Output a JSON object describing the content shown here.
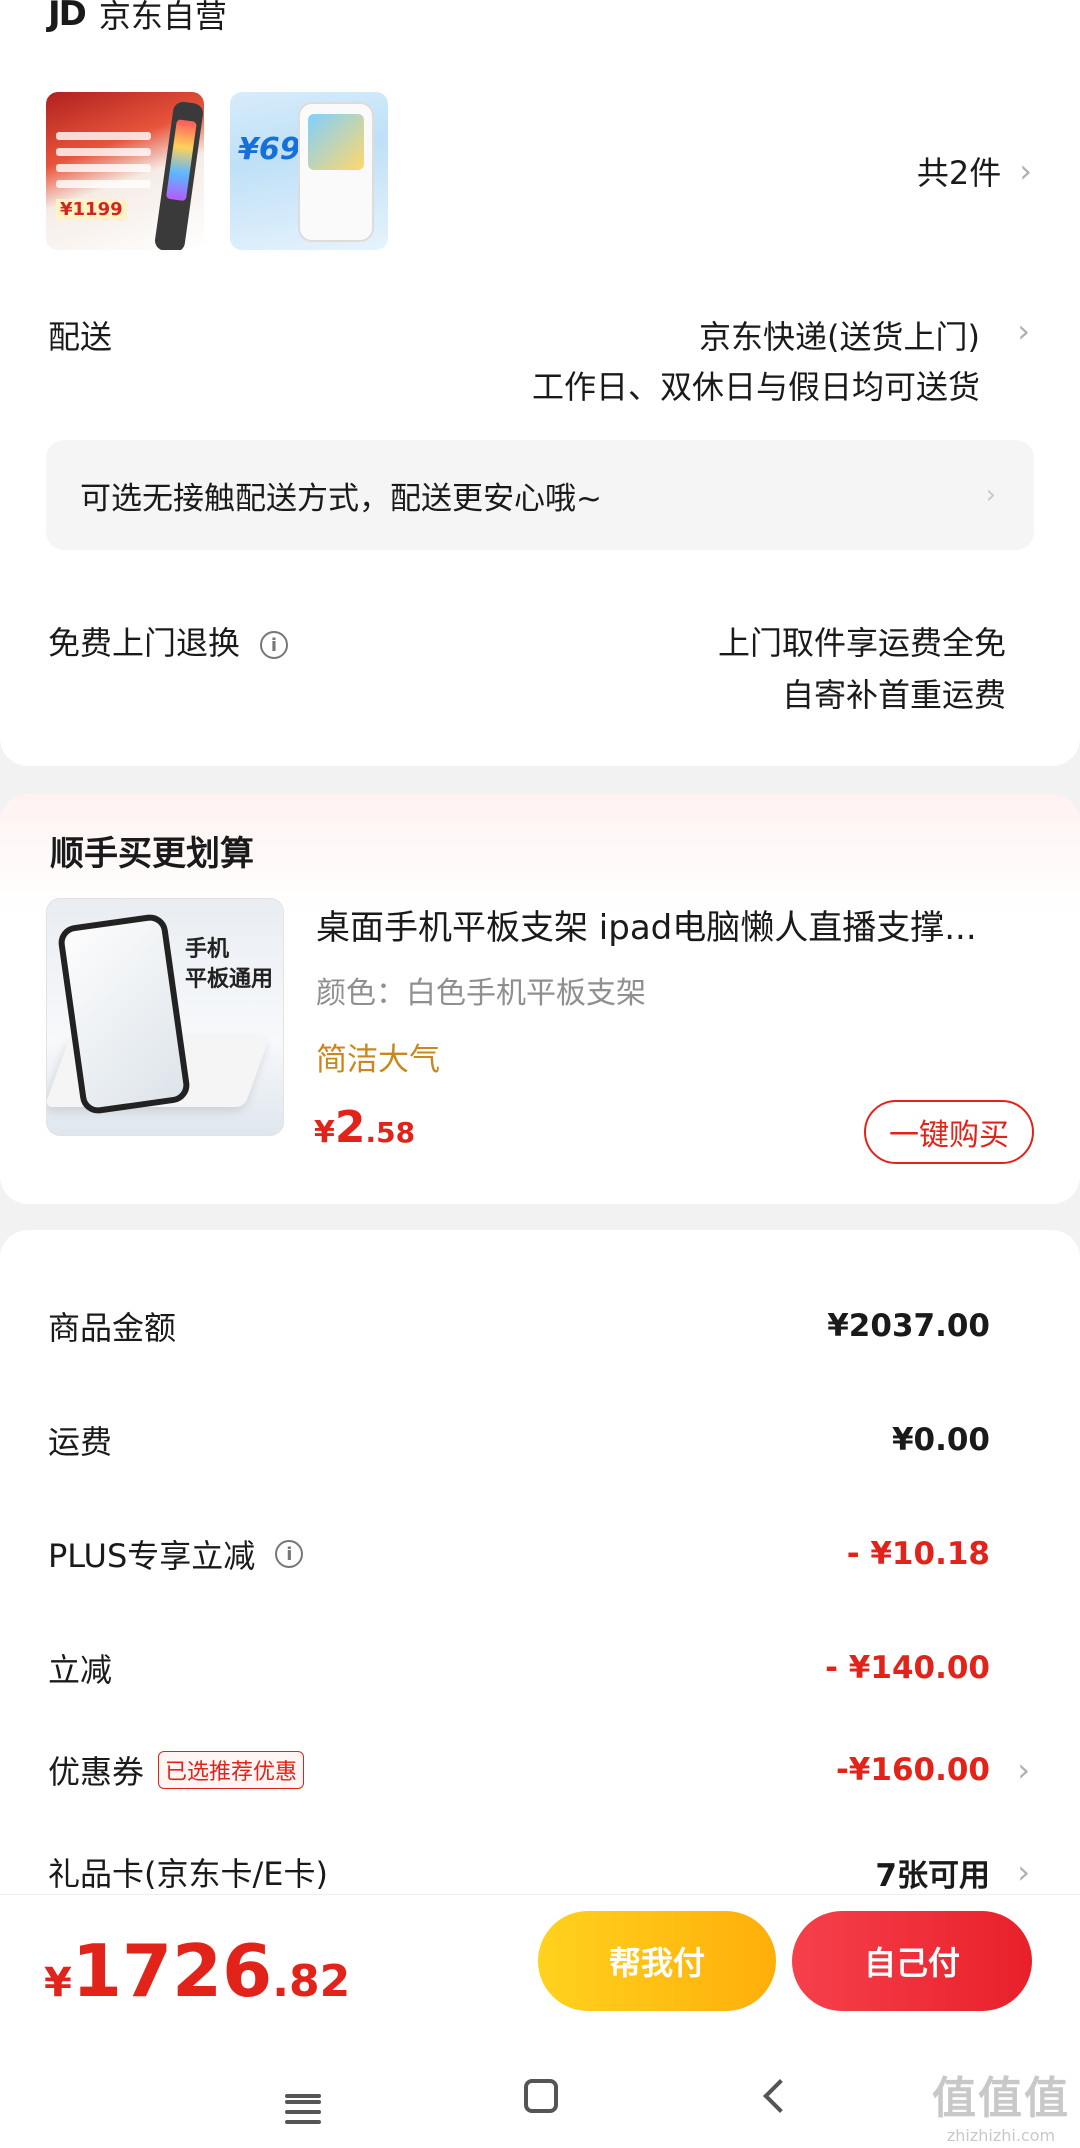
{
  "shop": {
    "logo": "JD",
    "name": "京东自营"
  },
  "order": {
    "item_count": "共2件",
    "thumb1_price": "¥1199",
    "thumb2_price": "¥698",
    "delivery_label": "配送",
    "delivery_method": "京东快递(送货上门)",
    "delivery_time": "工作日、双休日与假日均可送货",
    "contactless_notice": "可选无接触配送方式，配送更安心哦~",
    "return_label": "免费上门退换",
    "return_line1": "上门取件享运费全免",
    "return_line2": "自寄补首重运费"
  },
  "recommend": {
    "title": "顺手买更划算",
    "image_text_line1": "手机",
    "image_text_line2": "平板通用",
    "product_name": "桌面手机平板支架 ipad电脑懒人直播支撑...",
    "spec": "颜色：白色手机平板支架",
    "tag": "简洁大气",
    "price_currency": "¥",
    "price_int": "2",
    "price_dec": ".58",
    "buy_button": "一键购买"
  },
  "price_rows": [
    {
      "label": "商品金额",
      "value": "¥2037.00"
    },
    {
      "label": "运费",
      "value": "¥0.00"
    },
    {
      "label": "PLUS专享立减",
      "value": "- ¥10.18"
    },
    {
      "label": "立减",
      "value": "- ¥140.00"
    },
    {
      "label": "优惠券",
      "badge": "已选推荐优惠",
      "value": "-¥160.00"
    },
    {
      "label": "礼品卡(京东卡/E卡)",
      "value": "7张可用"
    }
  ],
  "bottom": {
    "currency": "¥",
    "total_int": "1726",
    "total_dec": ".82",
    "help_pay_button": "帮我付",
    "self_pay_button": "自己付"
  },
  "watermark": {
    "big": "值值值",
    "small": "zhizhizhi.com"
  },
  "colors": {
    "accent_red": "#e2231a",
    "help_yellow": "#ffc10e",
    "tag_gold": "#c9871c"
  }
}
